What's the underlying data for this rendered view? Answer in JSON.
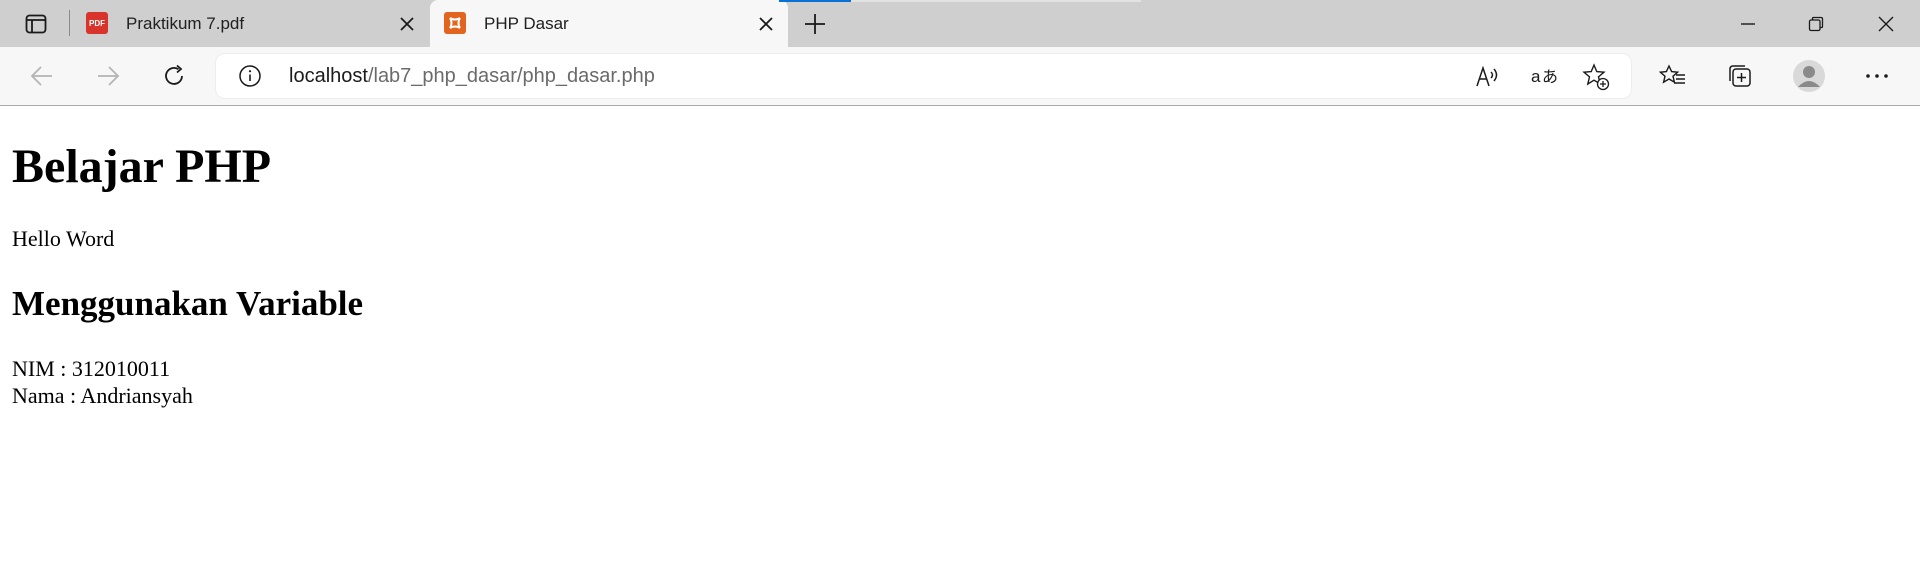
{
  "tabs": [
    {
      "title": "Praktikum 7.pdf",
      "icon": "pdf-icon",
      "icon_text": "PDF",
      "active": false
    },
    {
      "title": "PHP Dasar",
      "icon": "xampp-icon",
      "active": true
    }
  ],
  "address_bar": {
    "host": "localhost",
    "path": "/lab7_php_dasar/php_dasar.php"
  },
  "page": {
    "heading": "Belajar PHP",
    "greeting": "Hello Word",
    "subheading": "Menggunakan Variable",
    "nim_line": "NIM : 312010011",
    "nama_line": "Nama : Andriansyah"
  },
  "colors": {
    "accent": "#0a70d6",
    "pdf_icon": "#d9342b",
    "xampp_icon": "#e2651f"
  }
}
